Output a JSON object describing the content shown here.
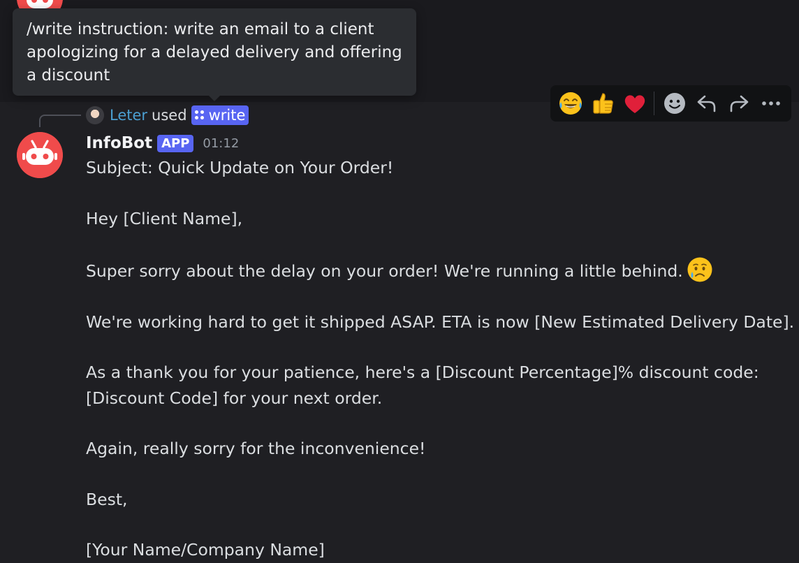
{
  "tooltip": {
    "text": "/write instruction: write an email to a client apologizing for a delayed delivery and offering a discount"
  },
  "reply": {
    "user": "Leter",
    "used": "used",
    "command": "write"
  },
  "message": {
    "author": "InfoBot",
    "badge": "APP",
    "time": "01:12",
    "lines": [
      "Subject: Quick Update on Your Order!",
      "",
      "Hey [Client Name],",
      "",
      "Super sorry about the delay on your order! We're running a little behind.",
      "",
      "We're working hard to get it shipped ASAP. ETA is now [New Estimated Delivery Date].",
      "",
      "As a thank you for your patience, here's a [Discount Percentage]% discount code:",
      "[Discount Code] for your next order.",
      "",
      "Again, really sorry for the inconvenience!",
      "",
      "Best,",
      "",
      "[Your Name/Company Name]"
    ]
  },
  "toolbar": {
    "reactions": [
      "joy-emoji",
      "thumbs-up-emoji",
      "red-heart-emoji"
    ],
    "actions": [
      "add-reaction",
      "reply",
      "forward",
      "more"
    ]
  },
  "colors": {
    "background": "#1f1f23",
    "accent": "#5865f2",
    "bot_avatar": "#f04b4b",
    "username_link": "#4b9fd1"
  }
}
